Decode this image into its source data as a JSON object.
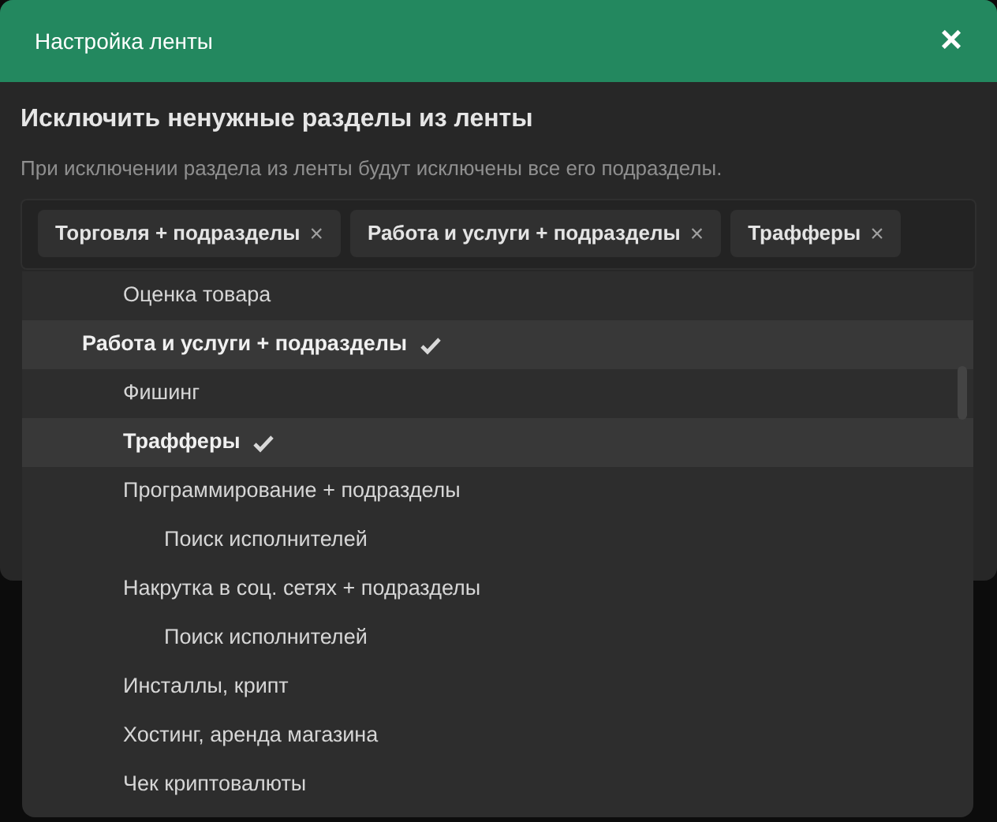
{
  "window": {
    "title": "Настройка ленты",
    "close": "×"
  },
  "heading": "Исключить ненужные разделы из ленты",
  "hint": "При исключении раздела из ленты будут исключены все его подразделы.",
  "tags": [
    {
      "label": "Торговля + подразделы",
      "remove": "×"
    },
    {
      "label": "Работа и услуги + подразделы",
      "remove": "×"
    },
    {
      "label": "Трафферы",
      "remove": "×"
    }
  ],
  "tree": [
    {
      "children": [
        {
          "label": "Оценка товара",
          "selected": false
        }
      ]
    },
    {
      "label": "Работа и услуги + подразделы",
      "selected": true,
      "children": [
        {
          "label": "Фишинг",
          "selected": false
        },
        {
          "label": "Трафферы",
          "selected": true
        },
        {
          "label": "Программирование + подразделы",
          "selected": false,
          "children": [
            {
              "label": "Поиск исполнителей",
              "selected": false
            }
          ]
        },
        {
          "label": "Накрутка в соц. сетях + подразделы",
          "selected": false,
          "children": [
            {
              "label": "Поиск исполнителей",
              "selected": false
            }
          ]
        },
        {
          "label": "Инсталлы, крипт",
          "selected": false
        },
        {
          "label": "Хостинг, аренда магазина",
          "selected": false
        },
        {
          "label": "Чек криптовалюты",
          "selected": false
        }
      ]
    }
  ]
}
